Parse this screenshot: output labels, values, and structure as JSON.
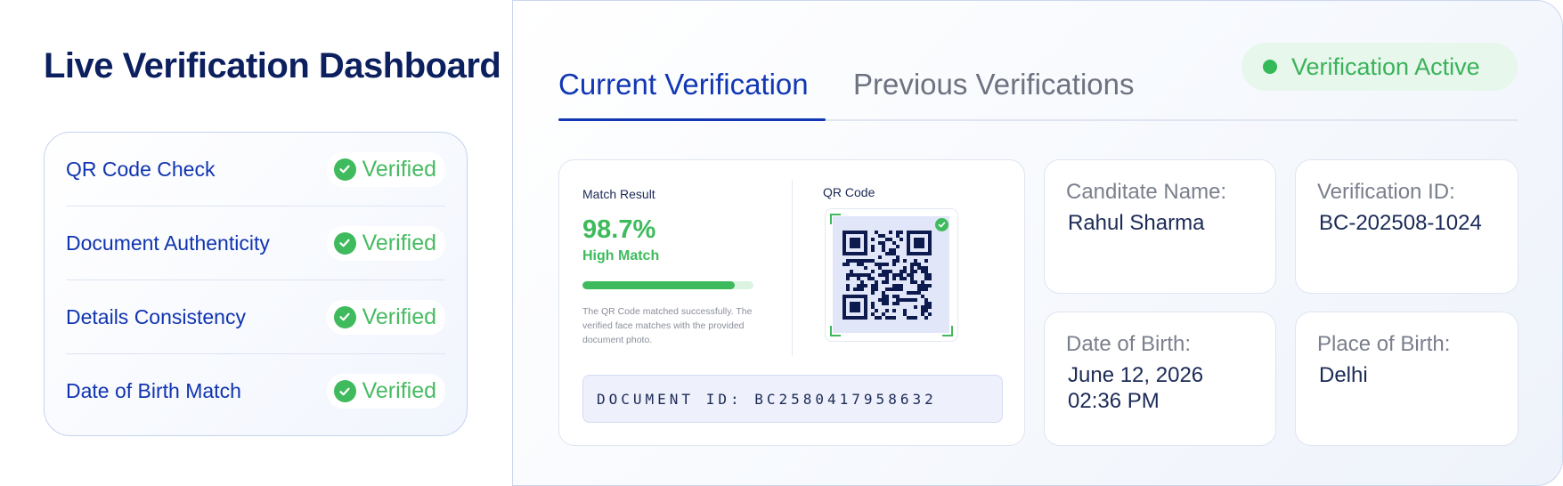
{
  "dashboard": {
    "title": "Live Verification Dashboard",
    "checks": [
      {
        "label": "QR Code Check",
        "status": "Verified"
      },
      {
        "label": "Document Authenticity",
        "status": "Verified"
      },
      {
        "label": "Details Consistency",
        "status": "Verified"
      },
      {
        "label": "Date of Birth Match",
        "status": "Verified"
      }
    ]
  },
  "tabs": [
    {
      "label": "Current Verification",
      "active": true
    },
    {
      "label": "Previous Verifications",
      "active": false
    }
  ],
  "status": {
    "label": "Verification Active",
    "color": "#33b957"
  },
  "match": {
    "result_label": "Match Result",
    "percent": "98.7%",
    "percent_value": 0.987,
    "level": "High Match",
    "description": "The QR Code matched successfully. The verified face matches with the provided document photo.",
    "qr_label": "QR Code",
    "document_id": "DOCUMENT ID: BC2580417958632"
  },
  "details": {
    "candidate_name_label": "Canditate Name:",
    "candidate_name": "Rahul Sharma",
    "verification_id_label": "Verification ID:",
    "verification_id": "BC-202508-1024",
    "dob_label": "Date of Birth:",
    "dob_date": "June 12, 2026",
    "dob_time": "02:36 PM",
    "pob_label": "Place of Birth:",
    "pob": "Delhi"
  },
  "colors": {
    "accent": "#1137b4",
    "success": "#3dbb5c",
    "qr_dark": "#0c1a4d"
  }
}
